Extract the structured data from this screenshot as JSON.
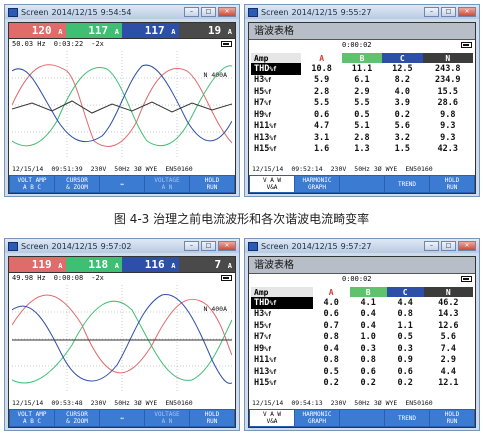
{
  "caption": "图 4-3 治理之前电流波形和各次谐波电流畸变率",
  "screens": [
    {
      "title_app": "Screen",
      "title_date": "2014/12/15",
      "title_time": "9:54:54",
      "readings": [
        {
          "value": "120",
          "unit": "A"
        },
        {
          "value": "117",
          "unit": "A"
        },
        {
          "value": "117",
          "unit": "A"
        },
        {
          "value": "19",
          "unit": "A"
        }
      ],
      "freq": "50.03 Hz",
      "elapsed": "0:03:22",
      "zoom": "-2x",
      "n_label": "N 400A",
      "footer_date": "12/15/14",
      "footer_time": "09:51:39",
      "footer_volt": "230V",
      "footer_freq": "50Hz 3Ø WYE",
      "footer_std": "EN50160",
      "softkeys": [
        "VOLT AMP\nA B C",
        "CURSOR\n& ZOOM",
        "↔",
        "VOLTAGE\nA N",
        "HOLD\nRUN"
      ]
    },
    {
      "title_app": "Screen",
      "title_date": "2014/12/15",
      "title_time": "9:55:27",
      "header": "谐波表格",
      "elapsed": "0:00:02",
      "cols": [
        "Amp",
        "A",
        "B",
        "C",
        "N"
      ],
      "rows": [
        {
          "label": "THD",
          "sub": "%f",
          "vals": [
            "10.8",
            "11.1",
            "12.5",
            "243.8"
          ]
        },
        {
          "label": "H3",
          "sub": "%f",
          "vals": [
            "5.9",
            "6.1",
            "8.2",
            "234.9"
          ]
        },
        {
          "label": "H5",
          "sub": "%f",
          "vals": [
            "2.8",
            "2.9",
            "4.0",
            "15.5"
          ]
        },
        {
          "label": "H7",
          "sub": "%f",
          "vals": [
            "5.5",
            "5.5",
            "3.9",
            "28.6"
          ]
        },
        {
          "label": "H9",
          "sub": "%f",
          "vals": [
            "0.6",
            "0.5",
            "0.2",
            "9.8"
          ]
        },
        {
          "label": "H11",
          "sub": "%f",
          "vals": [
            "4.7",
            "5.1",
            "5.6",
            "9.3"
          ]
        },
        {
          "label": "H13",
          "sub": "%f",
          "vals": [
            "3.1",
            "2.8",
            "3.2",
            "9.3"
          ]
        },
        {
          "label": "H15",
          "sub": "%f",
          "vals": [
            "1.6",
            "1.3",
            "1.5",
            "42.3"
          ]
        }
      ],
      "footer_date": "12/15/14",
      "footer_time": "09:52:14",
      "footer_volt": "230V",
      "footer_freq": "50Hz 3Ø WYE",
      "footer_std": "EN50160",
      "softkeys": [
        "V A W\nV&A",
        "HARMONIC\nGRAPH",
        "",
        "TREND",
        "HOLD\nRUN"
      ]
    },
    {
      "title_app": "Screen",
      "title_date": "2014/12/15",
      "title_time": "9:57:02",
      "readings": [
        {
          "value": "119",
          "unit": "A"
        },
        {
          "value": "118",
          "unit": "A"
        },
        {
          "value": "116",
          "unit": "A"
        },
        {
          "value": "7",
          "unit": "A"
        }
      ],
      "freq": "49.98 Hz",
      "elapsed": "0:00:08",
      "zoom": "-2x",
      "n_label": "N 400A",
      "footer_date": "12/15/14",
      "footer_time": "09:53:48",
      "footer_volt": "230V",
      "footer_freq": "50Hz 3Ø WYE",
      "footer_std": "EN50160",
      "softkeys": [
        "VOLT AMP\nA B C",
        "CURSOR\n& ZOOM",
        "↔",
        "VOLTAGE\nA N",
        "HOLD\nRUN"
      ]
    },
    {
      "title_app": "Screen",
      "title_date": "2014/12/15",
      "title_time": "9:57:27",
      "header": "谐波表格",
      "elapsed": "0:00:02",
      "cols": [
        "Amp",
        "A",
        "B",
        "C",
        "N"
      ],
      "rows": [
        {
          "label": "THD",
          "sub": "%f",
          "vals": [
            "4.0",
            "4.1",
            "4.4",
            "46.2"
          ]
        },
        {
          "label": "H3",
          "sub": "%f",
          "vals": [
            "0.6",
            "0.4",
            "0.8",
            "14.3"
          ]
        },
        {
          "label": "H5",
          "sub": "%f",
          "vals": [
            "0.7",
            "0.4",
            "1.1",
            "12.6"
          ]
        },
        {
          "label": "H7",
          "sub": "%f",
          "vals": [
            "0.8",
            "1.0",
            "0.5",
            "5.6"
          ]
        },
        {
          "label": "H9",
          "sub": "%f",
          "vals": [
            "0.4",
            "0.3",
            "0.3",
            "7.4"
          ]
        },
        {
          "label": "H11",
          "sub": "%f",
          "vals": [
            "0.8",
            "0.8",
            "0.9",
            "2.9"
          ]
        },
        {
          "label": "H13",
          "sub": "%f",
          "vals": [
            "0.5",
            "0.6",
            "0.6",
            "4.4"
          ]
        },
        {
          "label": "H15",
          "sub": "%f",
          "vals": [
            "0.2",
            "0.2",
            "0.2",
            "12.1"
          ]
        }
      ],
      "footer_date": "12/15/14",
      "footer_time": "09:54:13",
      "footer_volt": "230V",
      "footer_freq": "50Hz 3Ø WYE",
      "footer_std": "EN50160",
      "softkeys": [
        "V A W\nV&A",
        "HARMONIC\nGRAPH",
        "",
        "TREND",
        "HOLD\nRUN"
      ]
    }
  ],
  "colors": {
    "phase_a": "#e06b6b",
    "phase_b": "#3fbf74",
    "phase_c": "#2e4fa8",
    "neutral": "#4a4a4a"
  }
}
